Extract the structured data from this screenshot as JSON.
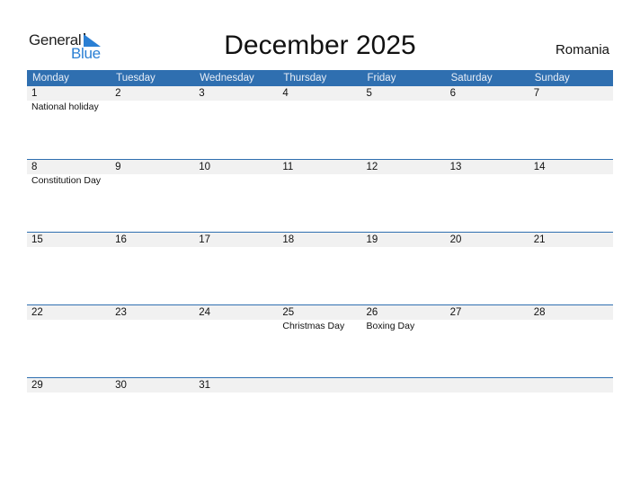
{
  "logo": {
    "line1": "General",
    "line2": "Blue"
  },
  "title": "December 2025",
  "country": "Romania",
  "colors": {
    "header_bg": "#2f6fb0",
    "date_strip": "#f1f1f1",
    "logo_blue": "#2a7fd4"
  },
  "weekdays": [
    "Monday",
    "Tuesday",
    "Wednesday",
    "Thursday",
    "Friday",
    "Saturday",
    "Sunday"
  ],
  "weeks": [
    [
      {
        "d": "1",
        "h": "National holiday"
      },
      {
        "d": "2",
        "h": ""
      },
      {
        "d": "3",
        "h": ""
      },
      {
        "d": "4",
        "h": ""
      },
      {
        "d": "5",
        "h": ""
      },
      {
        "d": "6",
        "h": ""
      },
      {
        "d": "7",
        "h": ""
      }
    ],
    [
      {
        "d": "8",
        "h": "Constitution Day"
      },
      {
        "d": "9",
        "h": ""
      },
      {
        "d": "10",
        "h": ""
      },
      {
        "d": "11",
        "h": ""
      },
      {
        "d": "12",
        "h": ""
      },
      {
        "d": "13",
        "h": ""
      },
      {
        "d": "14",
        "h": ""
      }
    ],
    [
      {
        "d": "15",
        "h": ""
      },
      {
        "d": "16",
        "h": ""
      },
      {
        "d": "17",
        "h": ""
      },
      {
        "d": "18",
        "h": ""
      },
      {
        "d": "19",
        "h": ""
      },
      {
        "d": "20",
        "h": ""
      },
      {
        "d": "21",
        "h": ""
      }
    ],
    [
      {
        "d": "22",
        "h": ""
      },
      {
        "d": "23",
        "h": ""
      },
      {
        "d": "24",
        "h": ""
      },
      {
        "d": "25",
        "h": "Christmas Day"
      },
      {
        "d": "26",
        "h": "Boxing Day"
      },
      {
        "d": "27",
        "h": ""
      },
      {
        "d": "28",
        "h": ""
      }
    ],
    [
      {
        "d": "29",
        "h": ""
      },
      {
        "d": "30",
        "h": ""
      },
      {
        "d": "31",
        "h": ""
      },
      {
        "d": "",
        "h": ""
      },
      {
        "d": "",
        "h": ""
      },
      {
        "d": "",
        "h": ""
      },
      {
        "d": "",
        "h": ""
      }
    ]
  ]
}
